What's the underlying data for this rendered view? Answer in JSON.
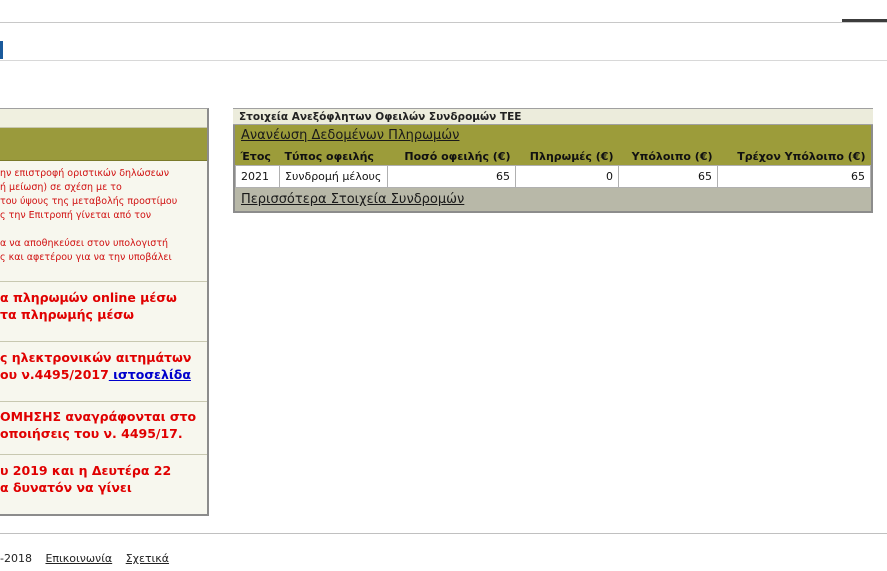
{
  "left_panel": {
    "small_lines": [
      "ην επιστροφή οριστικών δηλώσεων",
      "ή μείωση) σε σχέση με το",
      "του ύψους της μεταβολής προστίμου",
      "ς την Επιτροπή γίνεται από τον",
      "α να αποθηκεύσει στον υπολογιστή",
      "ς και αφετέρου για να την υποβάλει"
    ],
    "block1": [
      "α πληρωμών online μέσω",
      "τα πληρωμής μέσω"
    ],
    "block2_line1": "ς ηλεκτρονικών αιτημάτων",
    "block2_line2_text": "ου ν.4495/2017",
    "block2_link": " ιστοσελίδα",
    "block3": [
      "ΟΜΗΣΗΣ αναγράφονται στο",
      "οποιήσεις του ν. 4495/17."
    ],
    "block4": [
      "υ 2019 και η Δευτέρα 22",
      "α δυνατόν να γίνει"
    ]
  },
  "table": {
    "title": "Στοιχεία Ανεξόφλητων Οφειλών Συνδρομών ΤΕΕ",
    "refresh_link": "Ανανέωση Δεδομένων Πληρωμών",
    "headers": [
      "Έτος",
      "Τύπος οφειλής",
      "Ποσό οφειλής (€)",
      "Πληρωμές (€)",
      "Υπόλοιπο (€)",
      "Τρέχον Υπόλοιπο (€)"
    ],
    "rows": [
      [
        "2021",
        "Συνδρομή μέλους",
        "65",
        "0",
        "65",
        "65"
      ]
    ],
    "more_link": "Περισσότερα Στοιχεία Συνδρομών"
  },
  "footer": {
    "copyright": "-2018",
    "contact": "Επικοινωνία",
    "about": "Σχετικά"
  }
}
